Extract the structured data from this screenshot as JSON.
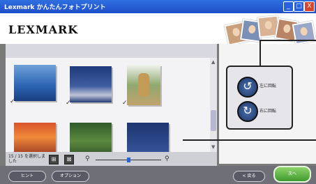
{
  "titlebar": {
    "title": "Lexmark かんたんフォトプリント",
    "min": "_",
    "max": "□",
    "close": "X"
  },
  "header": {
    "logo": "LEXMARK"
  },
  "gallery": {
    "thumbnails": [
      {
        "name": "blue-mountains",
        "checked": true
      },
      {
        "name": "ocean-wave",
        "checked": true
      },
      {
        "name": "dog-photo",
        "checked": true
      },
      {
        "name": "sunset",
        "checked": false
      },
      {
        "name": "flowers",
        "checked": false
      },
      {
        "name": "sea",
        "checked": false
      }
    ],
    "check_mark": "✓"
  },
  "rotate": {
    "left_label": "左に回転",
    "right_label": "右に回転"
  },
  "status": {
    "selection_text": "15 / 15 を選択しました"
  },
  "buttons": {
    "hint": "ヒント",
    "options": "オプション",
    "back": "< 戻る",
    "next": "次へ"
  },
  "colors": {
    "titlebar": "#1f4fc9",
    "next_button": "#3e9a2e",
    "rotate_button": "#1e3766"
  }
}
